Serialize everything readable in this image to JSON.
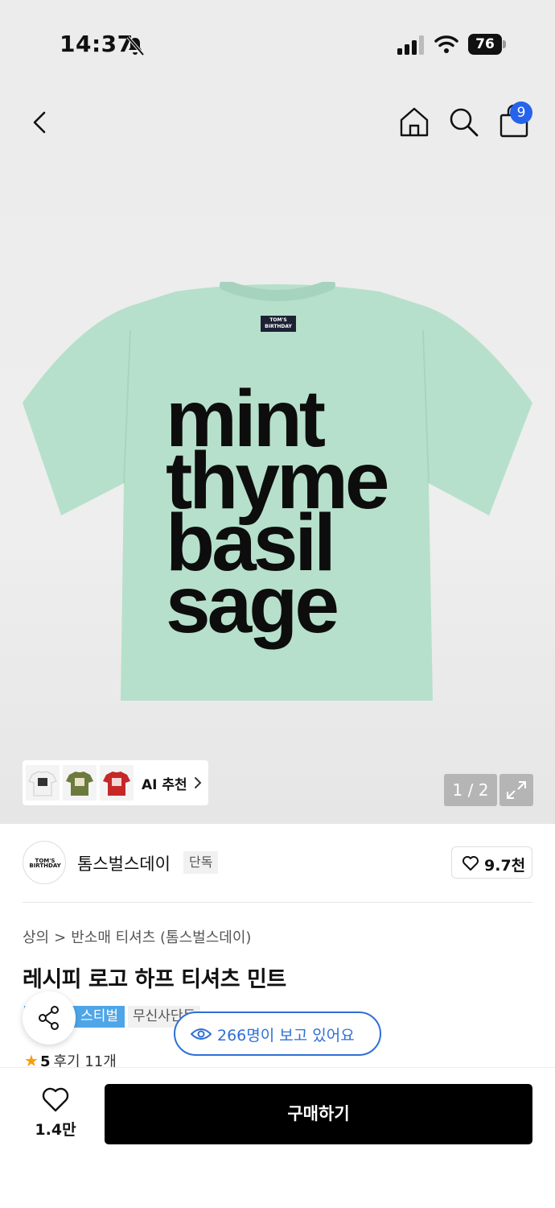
{
  "status_bar": {
    "time": "14:37",
    "battery": "76"
  },
  "nav": {
    "cart_count": "9"
  },
  "product_image": {
    "label_lines": [
      "TOM'S",
      "BIRTHDAY"
    ],
    "print_lines": [
      "mint",
      "thyme",
      "basil",
      "sage"
    ]
  },
  "ai_recommend": {
    "label": "AI 추천",
    "thumbs": [
      {
        "color": "#f2f2f2",
        "text": "milk bread cheese oreo"
      },
      {
        "color": "#6d7a3e",
        "text": "pesto olive salad carrot"
      },
      {
        "color": "#c62828",
        "text": "apple tomato chilli cherry"
      }
    ]
  },
  "gallery": {
    "indicator": "1 / 2"
  },
  "brand": {
    "logo_text": "TOM'S BIRTHDAY",
    "name": "톰스벌스데이",
    "tag": "단독",
    "like_count": "9.7천"
  },
  "breadcrumb": {
    "category": "상의",
    "subcategory": "반소매 티셔츠 (톰스벌스데이)"
  },
  "product": {
    "title": "레시피 로고 하프 티셔츠 민트",
    "tag_festival": "스티벌",
    "tag_shipping": "무신사단독",
    "rating": "5",
    "reviews": "후기 11개"
  },
  "viewers": "266명이 보고 있어요",
  "bottom": {
    "wish_count": "1.4만",
    "buy_label": "구매하기"
  },
  "colors": {
    "accent": "#2f6fd6",
    "badge": "#2563eb",
    "shirt": "#b6e0cb",
    "star": "#f59e0b"
  }
}
